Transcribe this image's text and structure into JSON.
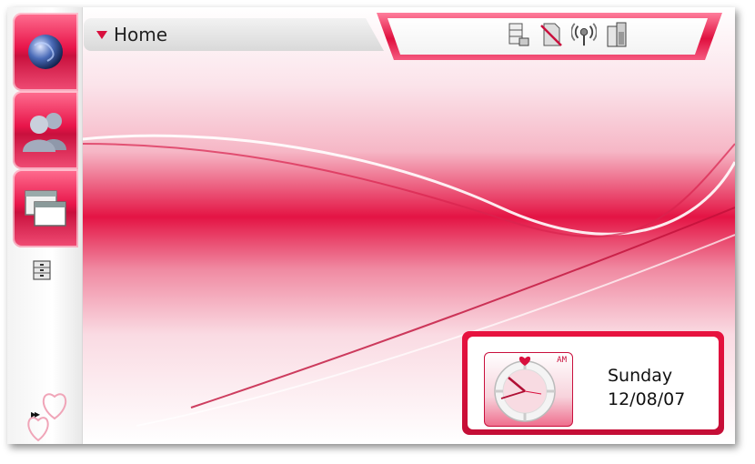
{
  "title": {
    "text": "Home"
  },
  "sidebar": {
    "items": [
      {
        "icon": "globe-icon"
      },
      {
        "icon": "contacts-icon"
      },
      {
        "icon": "windows-icon"
      },
      {
        "icon": "filing-cabinet-icon"
      }
    ],
    "more_label": "▸▸"
  },
  "status_icons": [
    "file-manager-icon",
    "no-sim-icon",
    "wireless-icon",
    "battery-icon"
  ],
  "clock_widget": {
    "ampm": "AM",
    "day": "Sunday",
    "date": "12/08/07"
  },
  "colors": {
    "accent": "#e41444",
    "accent_dark": "#c40d36"
  }
}
